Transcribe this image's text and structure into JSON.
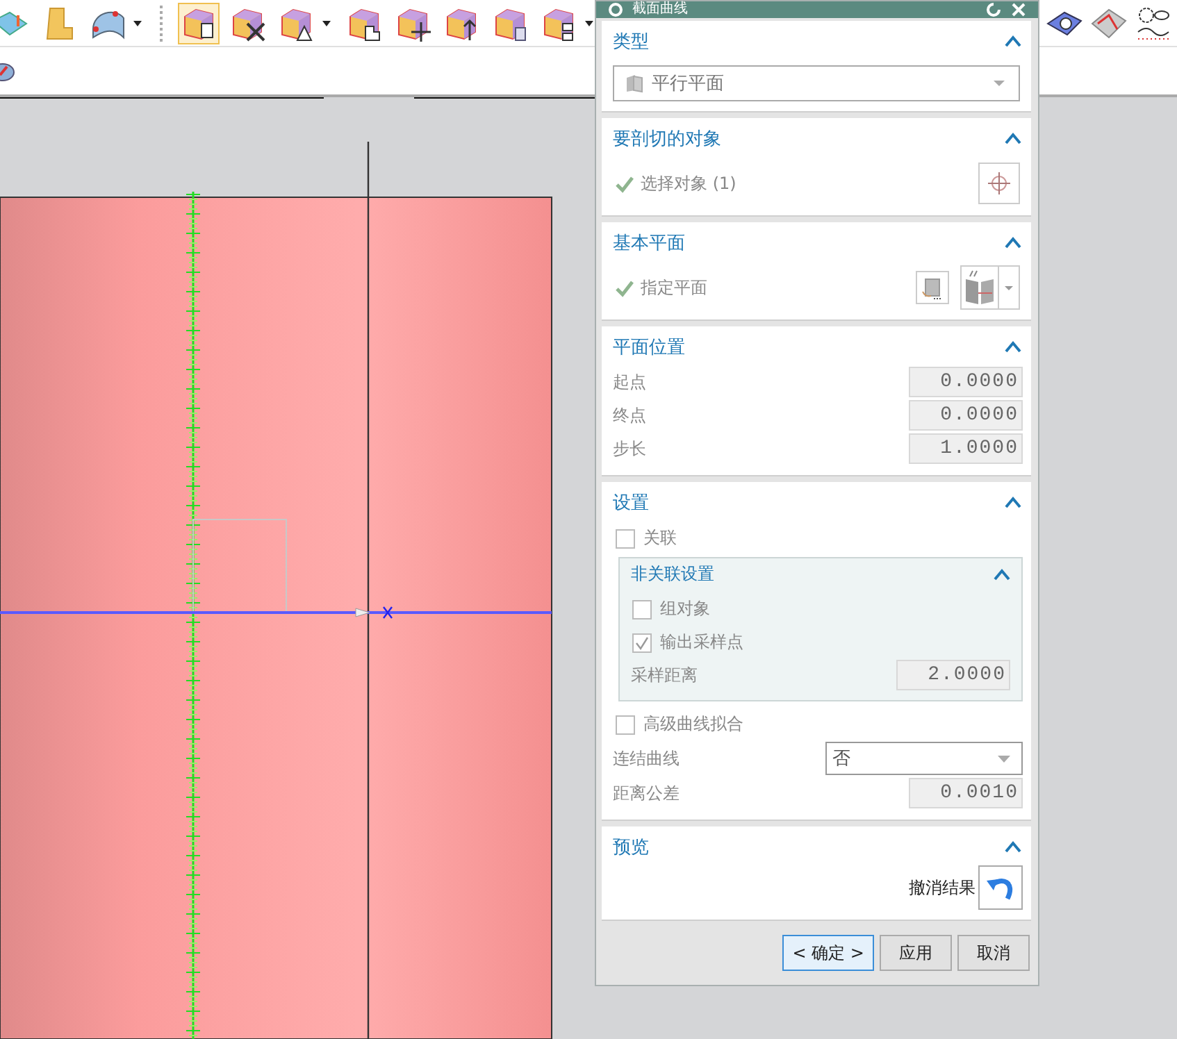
{
  "toolbar": {
    "buttons": [
      {
        "selected": false,
        "menu": false
      },
      {
        "selected": false,
        "menu": false
      },
      {
        "selected": false,
        "menu": true
      },
      {
        "selected": true,
        "menu": false
      },
      {
        "selected": false,
        "menu": false
      },
      {
        "selected": false,
        "menu": true
      },
      {
        "selected": false,
        "menu": false
      },
      {
        "selected": false,
        "menu": false
      },
      {
        "selected": false,
        "menu": false
      },
      {
        "selected": false,
        "menu": false
      },
      {
        "selected": false,
        "menu": true
      }
    ],
    "right_buttons": [
      {
        "selected": false,
        "menu": false
      },
      {
        "selected": false,
        "menu": false
      },
      {
        "selected": false,
        "menu": false
      }
    ]
  },
  "dialog": {
    "title": "截面曲线",
    "sections": [
      {
        "title": "类型",
        "expanded": true,
        "rows": [
          {
            "kind": "dropdown",
            "value": "平行平面"
          }
        ]
      },
      {
        "title": "要剖切的对象",
        "expanded": true,
        "rows": [
          {
            "kind": "selection",
            "label": "选择对象 (1)",
            "done": true
          }
        ]
      },
      {
        "title": "基本平面",
        "expanded": true,
        "rows": [
          {
            "kind": "plane",
            "label": "指定平面",
            "done": true
          }
        ]
      },
      {
        "title": "平面位置",
        "expanded": true,
        "rows": [
          {
            "kind": "number",
            "label": "起点",
            "value": "0.0000"
          },
          {
            "kind": "number",
            "label": "终点",
            "value": "0.0000"
          },
          {
            "kind": "number",
            "label": "步长",
            "value": "1.0000"
          }
        ]
      },
      {
        "title": "设置",
        "expanded": true,
        "rows": [
          {
            "kind": "checkbox",
            "label": "关联",
            "checked": false
          },
          {
            "kind": "group",
            "title": "非关联设置",
            "expanded": true,
            "rows": [
              {
                "kind": "checkbox",
                "label": "组对象",
                "checked": false
              },
              {
                "kind": "checkbox",
                "label": "输出采样点",
                "checked": true
              },
              {
                "kind": "number",
                "label": "采样距离",
                "value": "2.0000"
              }
            ]
          },
          {
            "kind": "checkbox",
            "label": "高级曲线拟合",
            "checked": false
          },
          {
            "kind": "select",
            "label": "连结曲线",
            "value": "否"
          },
          {
            "kind": "number",
            "label": "距离公差",
            "value": "0.0010"
          }
        ]
      },
      {
        "title": "预览",
        "expanded": true,
        "rows": [
          {
            "kind": "action",
            "label": "撤消结果"
          }
        ]
      }
    ],
    "buttons": [
      {
        "label": "< 确定 >",
        "default": true
      },
      {
        "label": "应用",
        "default": false
      },
      {
        "label": "取消",
        "default": false
      }
    ]
  }
}
